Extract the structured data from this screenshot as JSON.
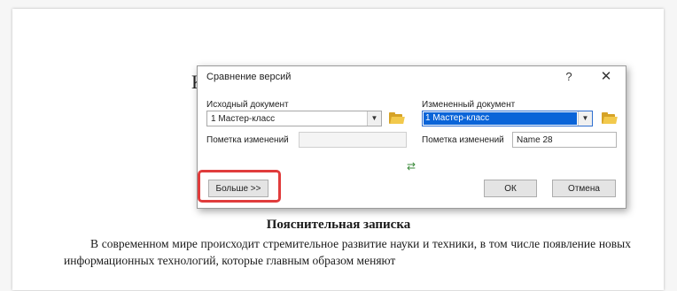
{
  "document": {
    "left_glyph": "К",
    "right_glyph": "¦",
    "heading": "Пояснительная записка",
    "paragraph": "В современном мире происходит стремительное развитие науки и техники, в том числе появление новых информационных технологий, которые главным образом меняют"
  },
  "dialog": {
    "title": "Сравнение версий",
    "help_label": "?",
    "close_label": "✕",
    "original": {
      "label": "Исходный документ",
      "value": "1 Мастер-класс",
      "mark_label": "Пометка изменений",
      "mark_value": ""
    },
    "revised": {
      "label": "Измененный документ",
      "value": "1 Мастер-класс",
      "mark_label": "Пометка изменений",
      "mark_value": "Name 28"
    },
    "more_button": "Больше >>",
    "ok_button": "ОК",
    "cancel_button": "Отмена"
  },
  "colors": {
    "highlight": "#e03c3c",
    "selection": "#0a64d8"
  }
}
